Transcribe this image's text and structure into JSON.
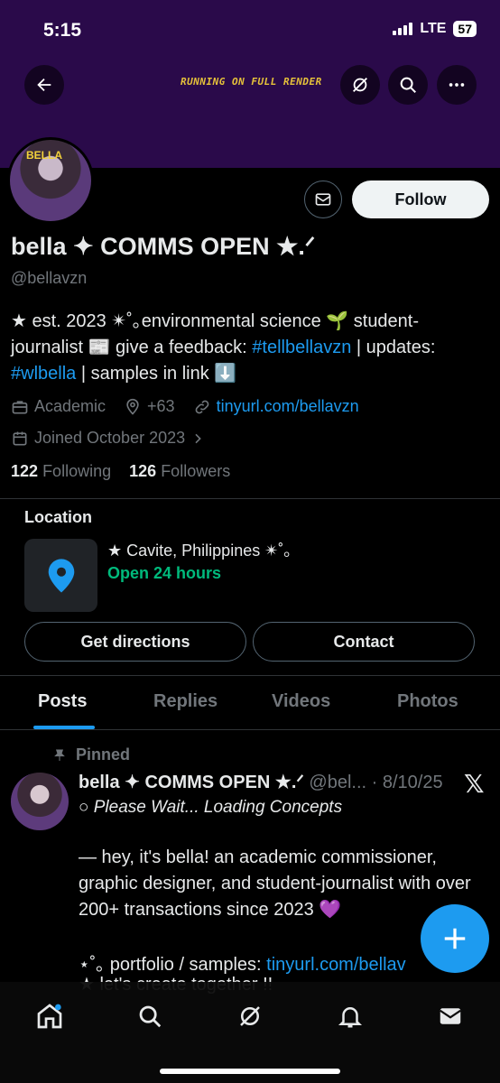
{
  "status_bar": {
    "time": "5:15",
    "network": "LTE",
    "battery": "57"
  },
  "header": {
    "banner_text": "RUNNING ON FULL RENDER",
    "avatar_overlay": "BELLA"
  },
  "actions": {
    "follow_label": "Follow"
  },
  "profile": {
    "name": "bella ✦ COMMS OPEN ★.ᐟ",
    "handle": "@bellavzn",
    "bio_part1": "★ est. 2023 ✴︎˚｡environmental science 🌱 student-journalist 📰 give a feedback: ",
    "bio_tag1": "#tellbellavzn",
    "bio_part2": " | updates: ",
    "bio_tag2": "#wlbella",
    "bio_part3": " | samples in link ⬇️",
    "category": "Academic",
    "location": "+63",
    "website": "tinyurl.com/bellavzn",
    "joined": "Joined October 2023",
    "following_count": "122",
    "following_label": "Following",
    "followers_count": "126",
    "followers_label": "Followers"
  },
  "location_card": {
    "title": "Location",
    "place": "★ Cavite, Philippines  ✴︎˚｡",
    "hours": "Open 24 hours",
    "directions_label": "Get directions",
    "contact_label": "Contact"
  },
  "tabs": [
    "Posts",
    "Replies",
    "Videos",
    "Photos"
  ],
  "pinned_post": {
    "pinned_label": "Pinned",
    "author": "bella ✦ COMMS OPEN ★.ᐟ",
    "handle_date": "@bel... · 8/10/25",
    "subtitle": "○ Please Wait... Loading Concepts",
    "body": "— hey, it's bella! an academic commissioner, graphic designer, and student-journalist with over 200+ transactions since 2023 💜",
    "portfolio_prefix": "⋆˚｡ portfolio / samples: ",
    "portfolio_link": "tinyurl.com/bellav",
    "line3": "★ let's create together !!"
  }
}
